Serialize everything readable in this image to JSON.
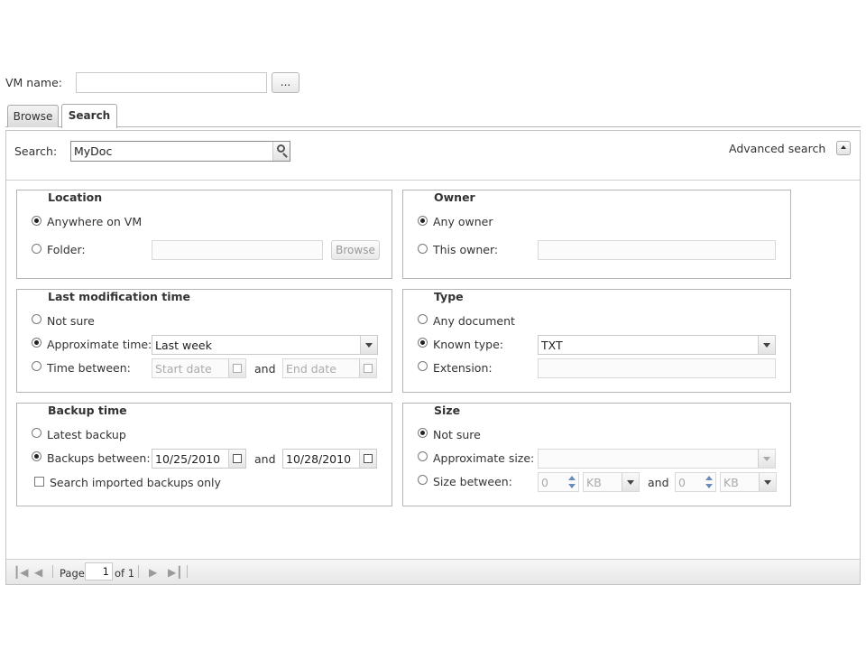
{
  "vm": {
    "label": "VM name:",
    "value": "",
    "browse_label": "..."
  },
  "tabs": [
    {
      "label": "Browse"
    },
    {
      "label": "Search"
    }
  ],
  "search": {
    "label": "Search:",
    "value": "MyDoc",
    "advanced_label": "Advanced search"
  },
  "location": {
    "title": "Location",
    "anywhere": "Anywhere on VM",
    "folder": "Folder:",
    "folder_value": "",
    "browse": "Browse",
    "selected": "anywhere"
  },
  "owner": {
    "title": "Owner",
    "any": "Any owner",
    "this": "This owner:",
    "this_value": "",
    "selected": "any"
  },
  "mod_time": {
    "title": "Last modification time",
    "not_sure": "Not sure",
    "approx": "Approximate time:",
    "approx_value": "Last week",
    "between": "Time between:",
    "start_placeholder": "Start date",
    "and": "and",
    "end_placeholder": "End date",
    "selected": "approx"
  },
  "type": {
    "title": "Type",
    "any": "Any document",
    "known": "Known type:",
    "known_value": "TXT",
    "extension": "Extension:",
    "extension_value": "",
    "selected": "known"
  },
  "backup_time": {
    "title": "Backup time",
    "latest": "Latest backup",
    "between": "Backups between:",
    "start": "10/25/2010",
    "and": "and",
    "end": "10/28/2010",
    "imported_only": "Search imported backups only",
    "imported_checked": false,
    "selected": "between"
  },
  "size": {
    "title": "Size",
    "not_sure": "Not sure",
    "approx": "Approximate size:",
    "approx_value": "",
    "between": "Size between:",
    "min": "0",
    "min_unit": "KB",
    "and": "and",
    "max": "0",
    "max_unit": "KB",
    "selected": "not_sure"
  },
  "pager": {
    "page_label": "Page",
    "page_value": "1",
    "of_label": "of 1"
  }
}
